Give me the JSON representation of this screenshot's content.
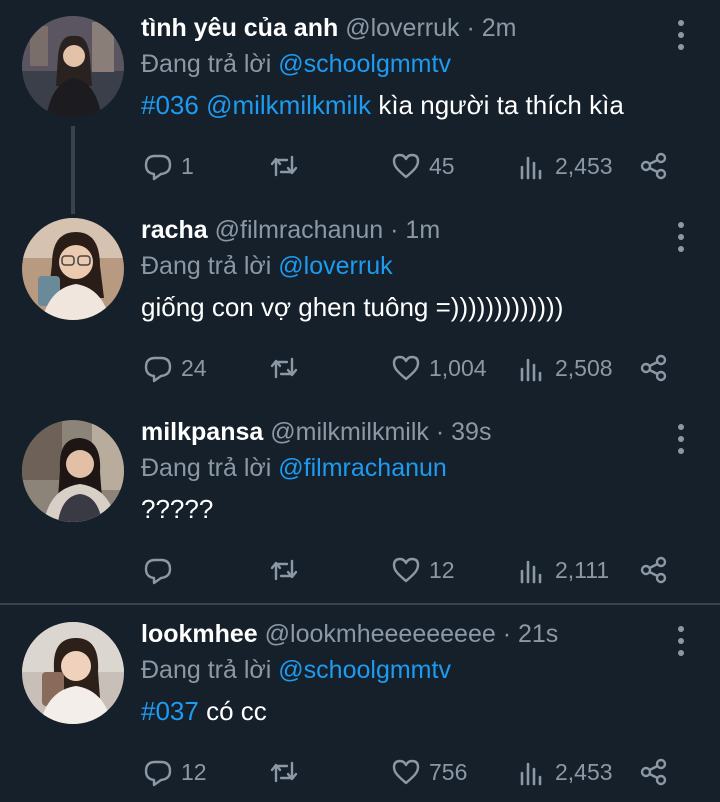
{
  "colors": {
    "background": "#15202b",
    "accent": "#1d9bf0",
    "muted": "#8b98a5",
    "divider": "#38444d"
  },
  "tweets": [
    {
      "display_name": "tình yêu của anh",
      "handle": "@loverruk",
      "time": "· 2m",
      "reply_prefix": "Đang trả lời",
      "reply_to": "@schoolgmmtv",
      "text_parts": [
        "#036",
        " ",
        "@milkmilkmilk",
        " kìa người ta thích kìa"
      ],
      "replies": "1",
      "retweets": "",
      "likes": "45",
      "views": "2,453"
    },
    {
      "display_name": "racha",
      "handle": "@filmrachanun",
      "time": "· 1m",
      "reply_prefix": "Đang trả lời",
      "reply_to": "@loverruk",
      "text": "giống con vợ ghen tuông =)))))))))))))",
      "replies": "24",
      "retweets": "",
      "likes": "1,004",
      "views": "2,508"
    },
    {
      "display_name": "milkpansa",
      "handle": "@milkmilkmilk",
      "time": "· 39s",
      "reply_prefix": "Đang trả lời",
      "reply_to": "@filmrachanun",
      "text": "?????",
      "replies": "",
      "retweets": "",
      "likes": "12",
      "views": "2,111"
    },
    {
      "display_name": "lookmhee",
      "handle": "@lookmheeeeeeeee",
      "time": "· 21s",
      "reply_prefix": "Đang trả lời",
      "reply_to": "@schoolgmmtv",
      "text_parts": [
        "#037",
        " có cc"
      ],
      "replies": "12",
      "retweets": "",
      "likes": "756",
      "views": "2,453"
    }
  ],
  "icons": [
    "reply-icon",
    "retweet-icon",
    "like-icon",
    "views-icon",
    "share-icon",
    "more-icon"
  ]
}
